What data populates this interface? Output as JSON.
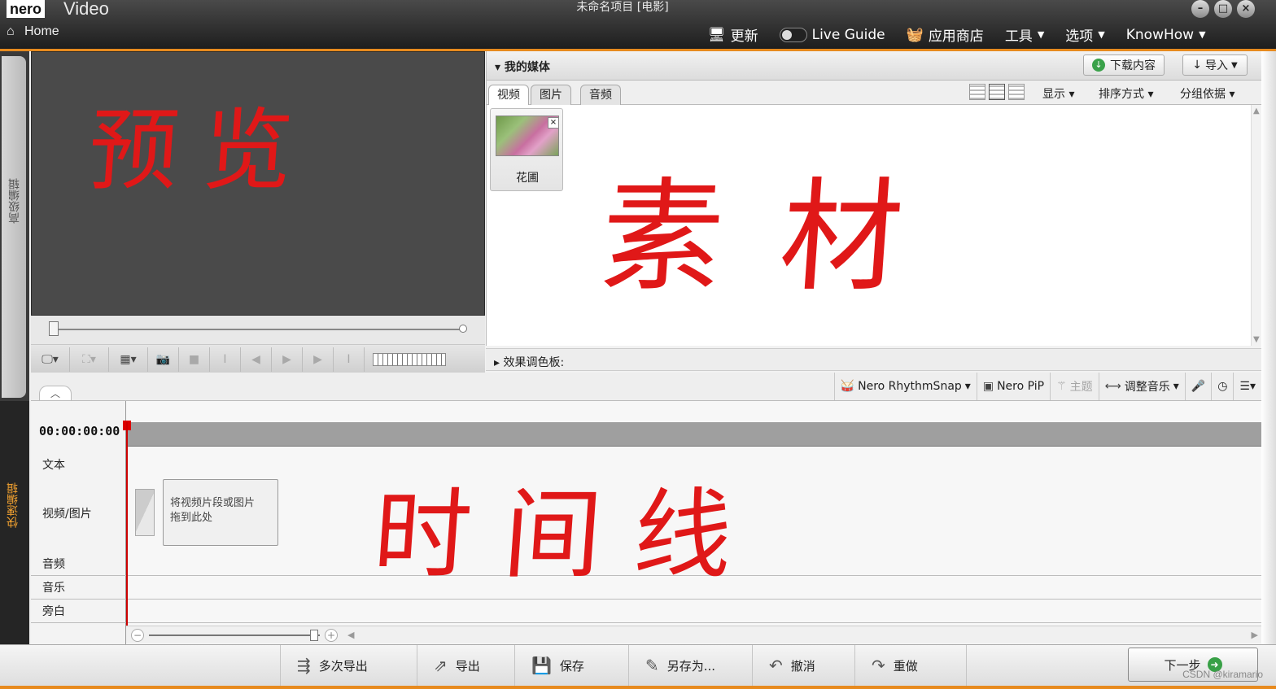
{
  "app": {
    "logo": "nero",
    "name": "Video",
    "window_title": "未命名项目 [电影]",
    "home_label": "Home"
  },
  "topnav": {
    "update": "更新",
    "live_guide": "Live Guide",
    "app_store": "应用商店",
    "tools": "工具",
    "options": "选项",
    "knowhow": "KnowHow"
  },
  "side_tabs": {
    "advanced": "高级编辑",
    "quick": "快速编辑"
  },
  "media": {
    "title": "我的媒体",
    "download_btn": "下载内容",
    "import_btn": "导入",
    "tabs": [
      "视频",
      "图片",
      "音频"
    ],
    "active_tab": 0,
    "dropdowns": {
      "display": "显示",
      "sort": "排序方式",
      "group": "分组依据"
    },
    "items": [
      {
        "label": "花圃"
      }
    ]
  },
  "effects_bar": "效果调色板:",
  "timeline_tools": {
    "rhythmsnap": "Nero RhythmSnap",
    "pip": "Nero PiP",
    "theme": "主题",
    "adjust_music": "调整音乐"
  },
  "timeline": {
    "timecode": "00:00:00:00",
    "tracks": [
      "文本",
      "视频/图片",
      "音频",
      "音乐",
      "旁白"
    ],
    "drop_hint_line1": "将视频片段或图片",
    "drop_hint_line2": "拖到此处"
  },
  "bottom_bar": {
    "multi_export": "多次导出",
    "export": "导出",
    "save": "保存",
    "save_as": "另存为...",
    "undo": "撤消",
    "redo": "重做",
    "next": "下一步"
  },
  "annotations": {
    "preview": "预览",
    "material": "素材",
    "timeline": "时间线"
  },
  "credit": "CSDN @kiramario",
  "colors": {
    "accent": "#e78a1e",
    "annotation": "#e01818"
  }
}
